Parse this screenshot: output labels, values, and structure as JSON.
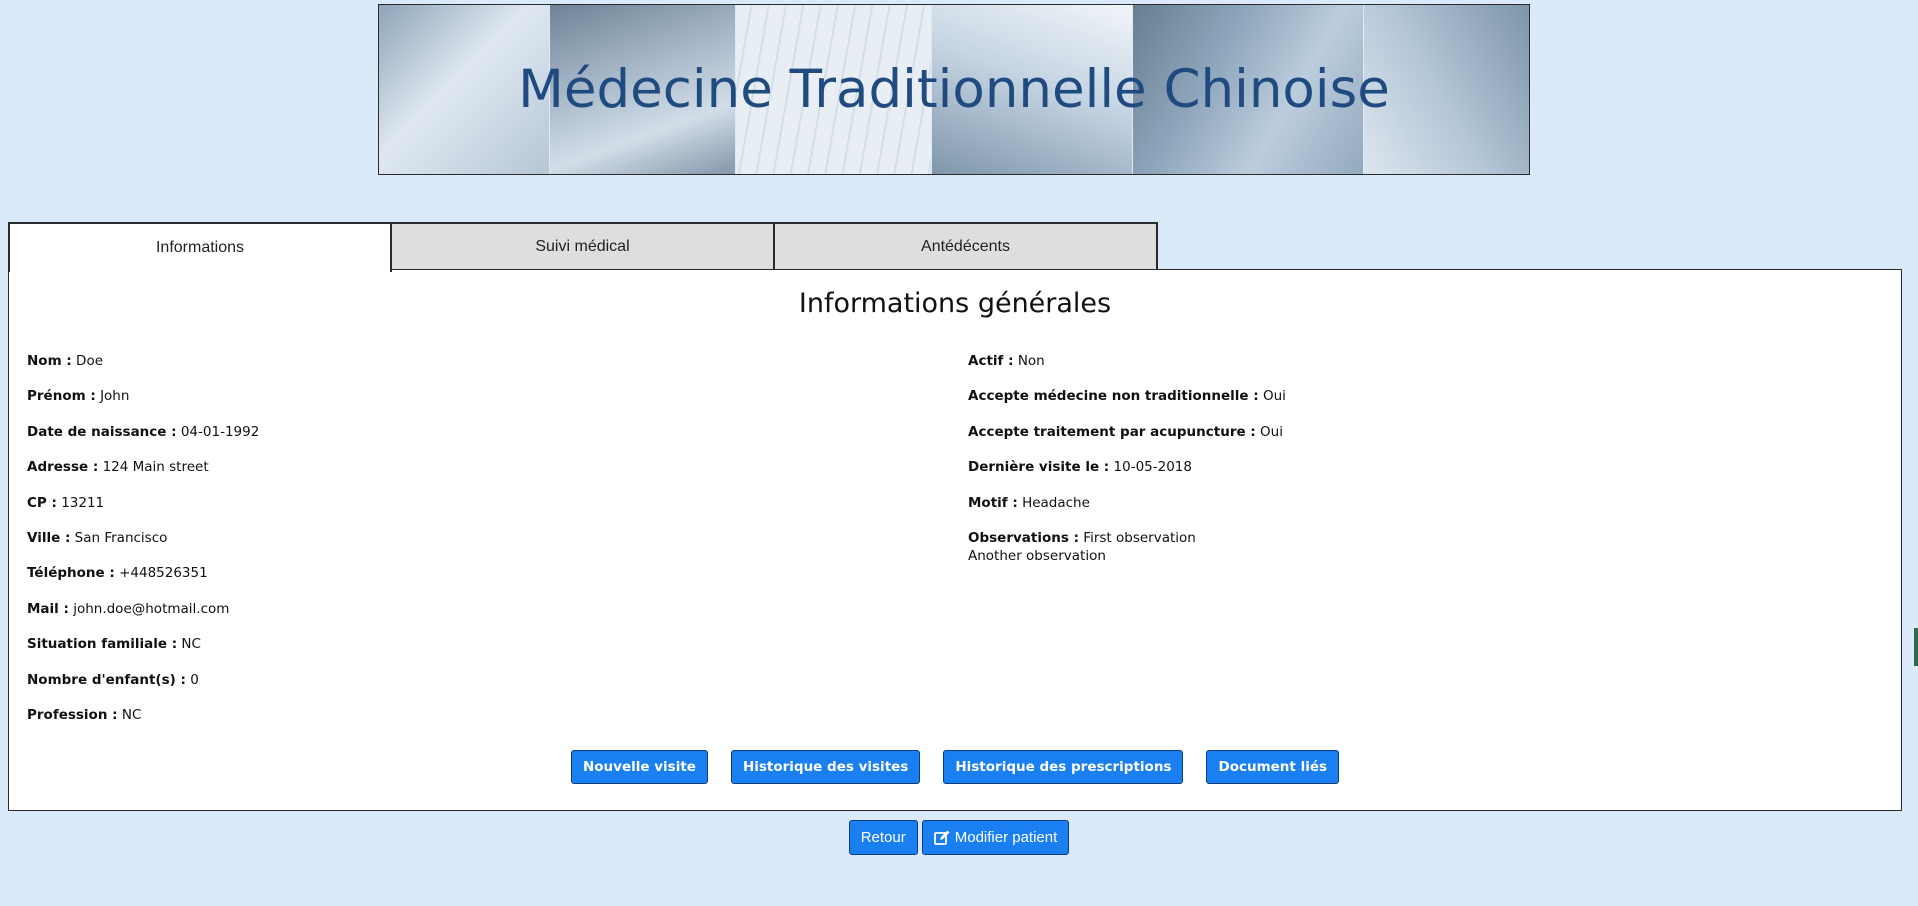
{
  "banner": {
    "title": "Médecine Traditionnelle Chinoise"
  },
  "tabs": [
    {
      "label": "Informations",
      "active": true
    },
    {
      "label": "Suivi médical",
      "active": false
    },
    {
      "label": "Antédécents",
      "active": false
    }
  ],
  "panel": {
    "title": "Informations générales",
    "left_fields": [
      {
        "label": "Nom :",
        "value": "Doe"
      },
      {
        "label": "Prénom :",
        "value": "John"
      },
      {
        "label": "Date de naissance :",
        "value": "04-01-1992"
      },
      {
        "label": "Adresse :",
        "value": "124 Main street"
      },
      {
        "label": "CP :",
        "value": "13211"
      },
      {
        "label": "Ville :",
        "value": "San Francisco"
      },
      {
        "label": "Téléphone :",
        "value": "+448526351"
      },
      {
        "label": "Mail :",
        "value": "john.doe@hotmail.com"
      },
      {
        "label": "Situation familiale :",
        "value": "NC"
      },
      {
        "label": "Nombre d'enfant(s) :",
        "value": "0"
      },
      {
        "label": "Profession :",
        "value": "NC"
      }
    ],
    "right_fields": [
      {
        "label": "Actif :",
        "value": "Non"
      },
      {
        "label": "Accepte médecine non traditionnelle :",
        "value": "Oui"
      },
      {
        "label": "Accepte traitement par acupuncture :",
        "value": "Oui"
      },
      {
        "label": "Dernière visite le :",
        "value": "10-05-2018"
      },
      {
        "label": "Motif :",
        "value": "Headache"
      },
      {
        "label": "Observations :",
        "value": "First observation",
        "extra": "Another observation"
      }
    ],
    "buttons": {
      "new_visit": "Nouvelle visite",
      "visit_history": "Historique des visites",
      "prescription_history": "Historique des prescriptions",
      "linked_documents": "Document liés"
    }
  },
  "actions": {
    "back": "Retour",
    "edit_patient": "Modifier patient"
  },
  "colors": {
    "background": "#dbeafb",
    "button": "#1a7ff0",
    "banner_title": "#1f4b80"
  }
}
